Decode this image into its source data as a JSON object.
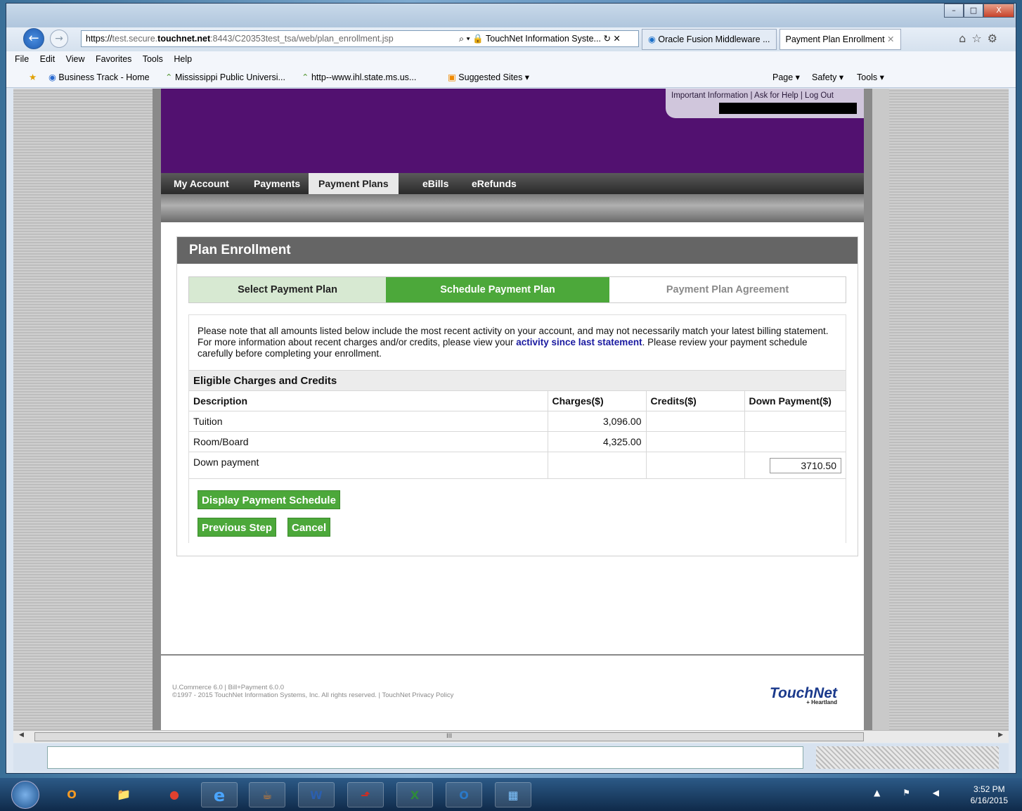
{
  "browser": {
    "url_scheme": "https://",
    "url_host_dim": "test.secure.",
    "url_host": "touchnet.net",
    "url_rest": ":8443/C20353test_tsa/web/plan_enrollment.jsp",
    "addr_controls": "⌕ ▾ 🔒",
    "addr_title": "TouchNet Information Syste...",
    "addr_icons": "↻ ✕",
    "tabs": [
      "Oracle Fusion Middleware ...",
      "Payment Plan Enrollment"
    ],
    "tab_close": "✕",
    "nav_icons": "⌂☆⚙",
    "menu": [
      "File",
      "Edit",
      "View",
      "Favorites",
      "Tools",
      "Help"
    ],
    "favorites": [
      "Business Track - Home",
      "Mississippi Public Universi...",
      "http--www.ihl.state.ms.us...",
      "Suggested Sites ▾"
    ],
    "command_bar": [
      "Page ▾",
      "Safety ▾",
      "Tools ▾"
    ],
    "window_buttons": [
      "–",
      "□",
      "X"
    ]
  },
  "site": {
    "top_links": "Important Information | Ask for Help | Log Out",
    "nav": [
      "My Account",
      "Payments",
      "Payment Plans",
      "eBills",
      "eRefunds"
    ],
    "active_nav": "Payment Plans"
  },
  "panel": {
    "title": "Plan Enrollment",
    "steps": [
      "Select Payment Plan",
      "Schedule Payment Plan",
      "Payment Plan Agreement"
    ],
    "notice_before": "Please note that all amounts listed below include the most recent activity on your account, and may not necessarily match your latest billing statement. For more information about recent charges and/or credits, please view your ",
    "notice_link": "activity since last statement",
    "notice_after": ". Please review your payment schedule carefully before completing your enrollment.",
    "section_title": "Eligible Charges and Credits",
    "columns": [
      "Description",
      "Charges($)",
      "Credits($)",
      "Down Payment($)"
    ],
    "rows": [
      {
        "description": "Tuition",
        "charges": "3,096.00",
        "credits": "",
        "down": ""
      },
      {
        "description": "Room/Board",
        "charges": "4,325.00",
        "credits": "",
        "down": ""
      }
    ],
    "down_payment_label": "Down payment",
    "down_payment_value": "3710.50",
    "buttons": {
      "display": "Display Payment Schedule",
      "previous": "Previous Step",
      "cancel": "Cancel"
    }
  },
  "footer": {
    "line1": "U.Commerce 6.0 | Bill+Payment 6.0.0",
    "line2": "©1997 - 2015 TouchNet Information Systems, Inc. All rights reserved. | TouchNet Privacy Policy",
    "logo_text": "TouchNet",
    "logo_sub": "+ Heartland"
  },
  "scrollbar": {
    "left": "◀",
    "grip": "III",
    "right": "▶"
  },
  "taskbar": {
    "apps": [
      "O",
      "📁",
      "●",
      "e",
      "☕",
      "W",
      "⬏",
      "X",
      "O",
      "▦"
    ],
    "tray": "▲ ⚑ ◀",
    "time": "3:52 PM",
    "date": "6/16/2015"
  },
  "colors": {
    "purple_header": "#521170",
    "green_active": "#4ca83a",
    "green_light": "#d7e9d2",
    "link_blue": "#1a1aa0"
  }
}
